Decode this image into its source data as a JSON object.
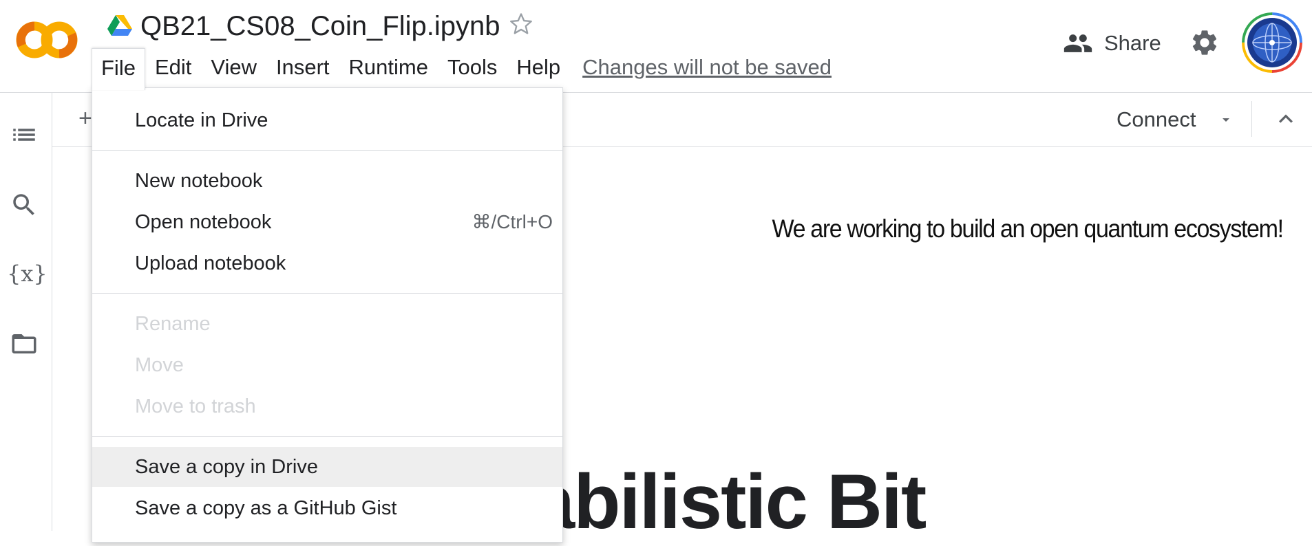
{
  "notebook": {
    "title": "QB21_CS08_Coin_Flip.ipynb"
  },
  "menubar": {
    "items": [
      "File",
      "Edit",
      "View",
      "Insert",
      "Runtime",
      "Tools",
      "Help"
    ],
    "changes_notice": "Changes will not be saved"
  },
  "header": {
    "share_label": "Share"
  },
  "toolbar": {
    "add_label": "+",
    "connect_label": "Connect"
  },
  "sidebar": {
    "variables_label": "{x}"
  },
  "file_menu": {
    "items": [
      {
        "label": "Locate in Drive",
        "enabled": true
      },
      {
        "label": "New notebook",
        "enabled": true
      },
      {
        "label": "Open notebook",
        "shortcut": "⌘/Ctrl+O",
        "enabled": true
      },
      {
        "label": "Upload notebook",
        "enabled": true
      },
      {
        "label": "Rename",
        "enabled": false
      },
      {
        "label": "Move",
        "enabled": false
      },
      {
        "label": "Move to trash",
        "enabled": false
      },
      {
        "label": "Save a copy in Drive",
        "enabled": true,
        "highlighted": true
      },
      {
        "label": "Save a copy as a GitHub Gist",
        "enabled": true
      }
    ]
  },
  "content": {
    "tagline": "We are working to build an open quantum ecosystem!",
    "heading_fragment": "obabilistic Bit"
  },
  "colors": {
    "logo_orange": "#F9AB00",
    "logo_dark_orange": "#E8710A",
    "accent_link": "#5f6368",
    "highlight_bg": "#eeeeee"
  }
}
